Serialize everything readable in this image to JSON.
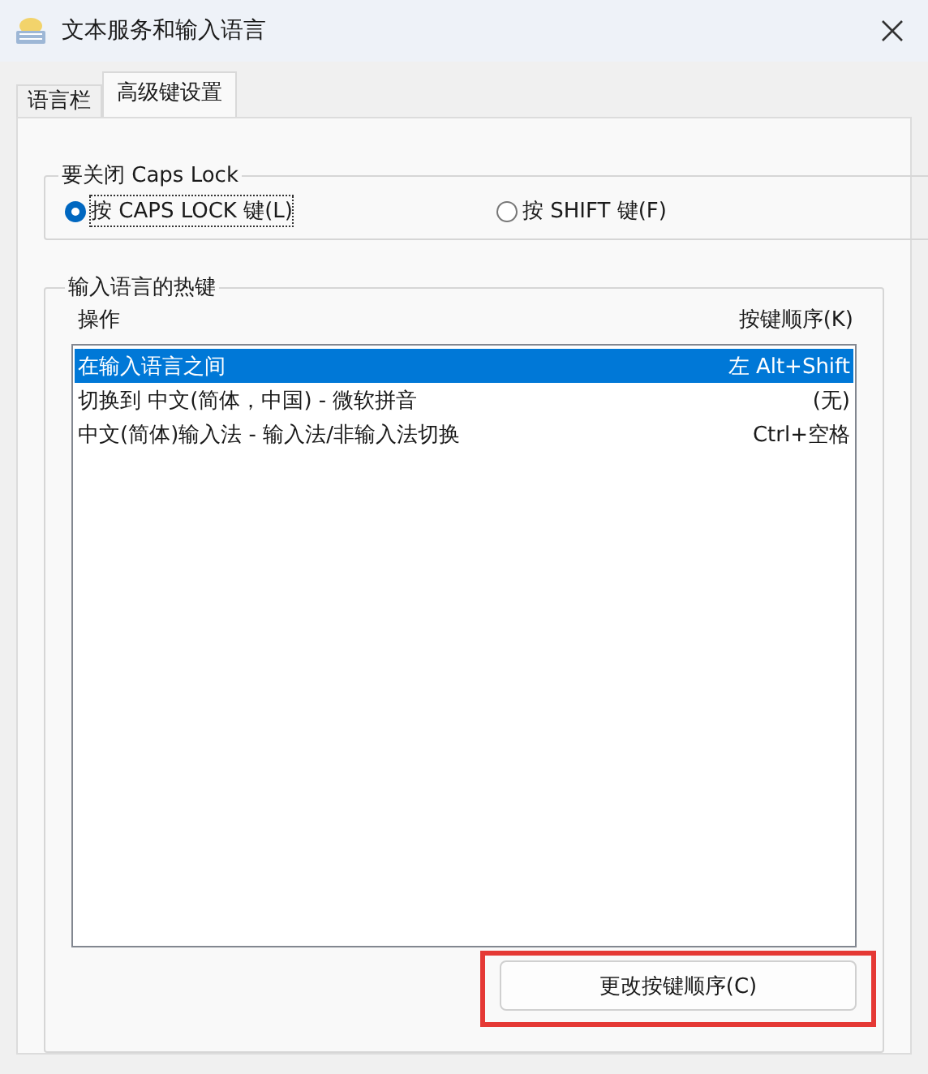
{
  "window": {
    "title": "文本服务和输入语言"
  },
  "tabs": [
    {
      "label": "语言栏",
      "selected": false
    },
    {
      "label": "高级键设置",
      "selected": true
    }
  ],
  "caps_lock_group": {
    "title": "要关闭 Caps Lock",
    "options": [
      {
        "label": "按 CAPS LOCK 键(L)",
        "selected": true
      },
      {
        "label": "按 SHIFT 键(F)",
        "selected": false
      }
    ]
  },
  "hotkeys_group": {
    "title": "输入语言的热键",
    "columns": [
      "操作",
      "按键顺序(K)"
    ],
    "rows": [
      {
        "action": "在输入语言之间",
        "keys": "左 Alt+Shift",
        "selected": true
      },
      {
        "action": "切换到 中文(简体，中国) - 微软拼音",
        "keys": "(无)",
        "selected": false
      },
      {
        "action": "中文(简体)输入法 - 输入法/非输入法切换",
        "keys": "Ctrl+空格",
        "selected": false
      }
    ],
    "button": "更改按键顺序(C)"
  }
}
